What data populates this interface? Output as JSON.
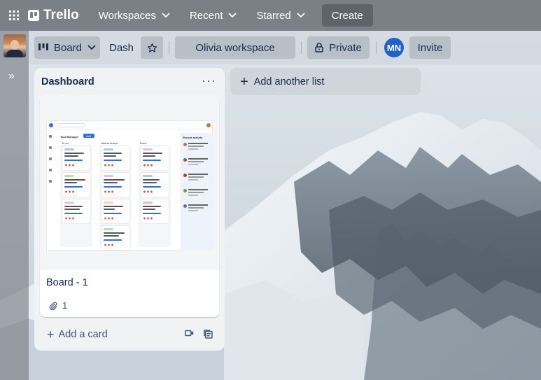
{
  "topbar": {
    "brand": "Trello",
    "workspaces_label": "Workspaces",
    "recent_label": "Recent",
    "starred_label": "Starred",
    "create_label": "Create"
  },
  "board_header": {
    "view_label": "Board",
    "board_name": "Dash",
    "workspace_label": "Olivia workspace",
    "visibility_label": "Private",
    "member_initials": "MN",
    "invite_label": "Invite"
  },
  "list": {
    "title": "Dashboard",
    "menu_label": "···",
    "card": {
      "title": "Board - 1",
      "attachment_count": "1"
    },
    "add_card_label": "Add a card"
  },
  "add_list_label": "Add another list",
  "cover_preview": {
    "app_title": "Task Manager",
    "add_button": "Add",
    "columns": [
      "To do",
      "Needs review",
      "Done"
    ],
    "sidebar_title": "Recent activity"
  },
  "colors": {
    "topbar": "#7b8087",
    "list_bg": "#f1f2f4",
    "avatar_blue": "#1d63c8",
    "text_primary": "#172b4d"
  }
}
